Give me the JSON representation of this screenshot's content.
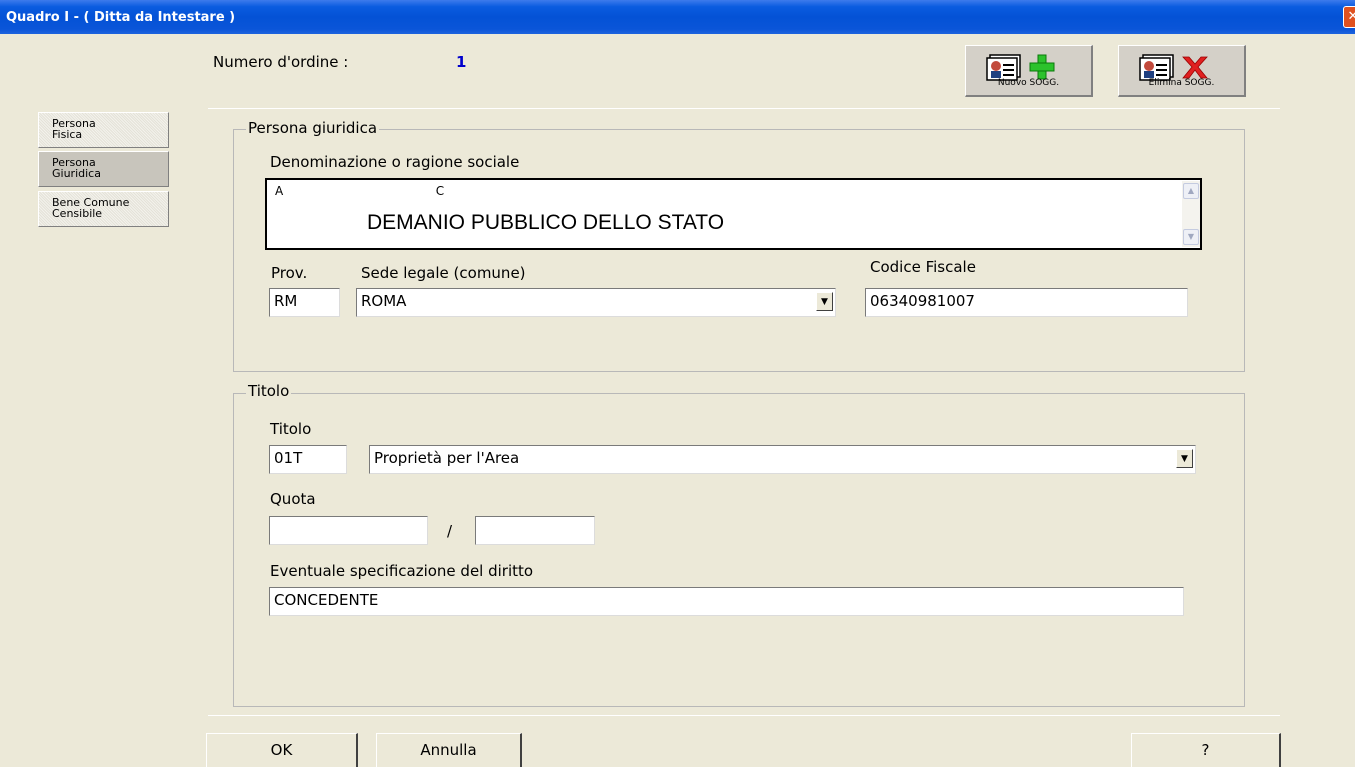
{
  "window": {
    "title": "Quadro I - ( Ditta da Intestare )",
    "close_glyph": "✕"
  },
  "header": {
    "order_label": "Numero d'ordine :",
    "order_value": "1"
  },
  "toolbar": {
    "new_label": "Nuovo SOGG.",
    "delete_label": "Elimina SOGG."
  },
  "sidebar": {
    "items": [
      {
        "label": "Persona\nFisica"
      },
      {
        "label": "Persona\nGiuridica"
      },
      {
        "label": "Bene Comune\nCensibile"
      }
    ]
  },
  "persona_giuridica": {
    "legend": "Persona giuridica",
    "denominazione_label": "Denominazione o ragione sociale",
    "denominazione_line1": "A                                        C",
    "denominazione_value": "DEMANIO PUBBLICO DELLO STATO",
    "prov_label": "Prov.",
    "prov_value": "RM",
    "sede_label": "Sede legale (comune)",
    "sede_value": "ROMA",
    "cf_label": "Codice Fiscale",
    "cf_value": "06340981007"
  },
  "titolo": {
    "legend": "Titolo",
    "titolo_label": "Titolo",
    "code_value": "01T",
    "desc_value": "Proprietà per l'Area",
    "quota_label": "Quota",
    "quota_num": "",
    "quota_sep": "/",
    "quota_den": "",
    "spec_label": "Eventuale specificazione del diritto",
    "spec_value": "CONCEDENTE"
  },
  "footer": {
    "ok_label": "OK",
    "cancel_label": "Annulla",
    "help_label": "?"
  },
  "icons": {
    "combo": "chevron-down-icon",
    "scroll_up": "arrow-up-icon",
    "scroll_down": "arrow-down-icon",
    "add": "plus-icon",
    "delete": "x-icon"
  },
  "colors": {
    "titlebar": "#0452d6",
    "order_value": "#0000cc",
    "add_icon": "#2cc22c",
    "delete_icon": "#e02020",
    "background": "#ece9d8"
  }
}
